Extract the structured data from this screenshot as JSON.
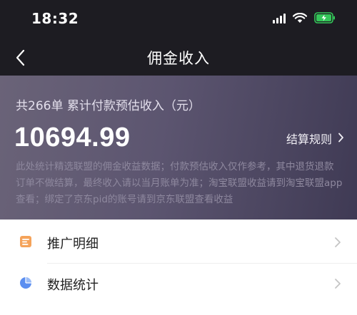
{
  "status_bar": {
    "time": "18:32",
    "icons": [
      "signal-icon",
      "wifi-icon",
      "battery-charging-icon"
    ],
    "battery_color": "#34c759"
  },
  "nav": {
    "title": "佣金收入",
    "back_icon": "chevron-left-icon"
  },
  "summary": {
    "caption": "共266单 累计付款预估收入（元）",
    "amount": "10694.99",
    "rules_label": "结算规则",
    "note": "此处统计精选联盟的佣金收益数据；付款预估收入仅作参考，其中退货退款订单不做结算，最终收入请以当月账单为准；淘宝联盟收益请到淘宝联盟app查看；绑定了京东pid的账号请到京东联盟查看收益"
  },
  "menu": {
    "items": [
      {
        "label": "推广明细",
        "icon": "document-list-icon",
        "icon_color": "#f5a35a"
      },
      {
        "label": "数据统计",
        "icon": "pie-chart-icon",
        "icon_color": "#5b8ef0"
      }
    ]
  }
}
